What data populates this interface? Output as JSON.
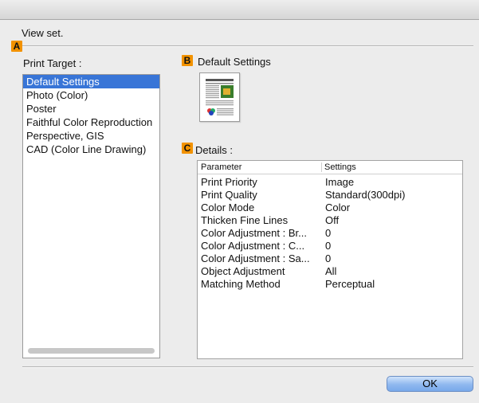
{
  "dialog": {
    "header": "View set."
  },
  "markers": {
    "a": "A",
    "b": "B",
    "c": "C"
  },
  "print_target": {
    "label": "Print Target :",
    "items": [
      {
        "label": "Default Settings",
        "selected": true
      },
      {
        "label": "Photo (Color)",
        "selected": false
      },
      {
        "label": "Poster",
        "selected": false
      },
      {
        "label": "Faithful Color Reproduction",
        "selected": false
      },
      {
        "label": "Perspective, GIS",
        "selected": false
      },
      {
        "label": "CAD (Color Line Drawing)",
        "selected": false
      }
    ]
  },
  "preview": {
    "label": "Default Settings"
  },
  "details": {
    "label": "Details :",
    "columns": {
      "parameter": "Parameter",
      "settings": "Settings"
    },
    "rows": [
      {
        "parameter": "Print Priority",
        "setting": "Image"
      },
      {
        "parameter": "Print Quality",
        "setting": "Standard(300dpi)"
      },
      {
        "parameter": "Color Mode",
        "setting": "Color"
      },
      {
        "parameter": "Thicken Fine Lines",
        "setting": "Off"
      },
      {
        "parameter": "Color Adjustment : Br...",
        "setting": "0"
      },
      {
        "parameter": "Color Adjustment : C...",
        "setting": "0"
      },
      {
        "parameter": "Color Adjustment : Sa...",
        "setting": "0"
      },
      {
        "parameter": "Object Adjustment",
        "setting": "All"
      },
      {
        "parameter": "Matching Method",
        "setting": "Perceptual"
      }
    ]
  },
  "buttons": {
    "ok": "OK"
  },
  "colors": {
    "marker": "#f29200",
    "selection": "#3875d7"
  }
}
